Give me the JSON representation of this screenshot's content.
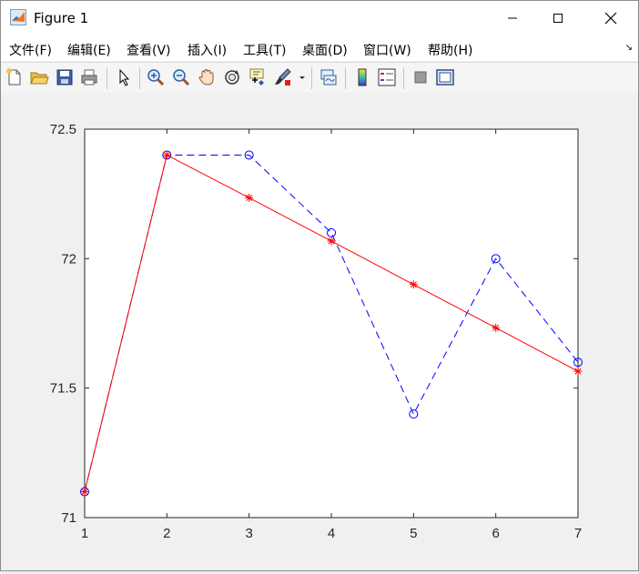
{
  "window": {
    "title": "Figure 1",
    "controls": [
      "minimize",
      "maximize",
      "close"
    ]
  },
  "menu": {
    "items": [
      "文件(F)",
      "编辑(E)",
      "查看(V)",
      "插入(I)",
      "工具(T)",
      "桌面(D)",
      "窗口(W)",
      "帮助(H)"
    ],
    "overflow_symbol": "↘"
  },
  "toolbar": {
    "icons": [
      "new-figure-icon",
      "open-file-icon",
      "save-icon",
      "print-icon",
      "edit-plot-arrow-icon",
      "zoom-in-icon",
      "zoom-out-icon",
      "pan-hand-icon",
      "rotate-3d-icon",
      "data-cursor-icon",
      "brush-icon",
      "link-plot-icon",
      "colorbar-icon",
      "legend-icon",
      "hide-plot-tools-icon",
      "show-plot-tools-icon"
    ]
  },
  "chart_data": {
    "type": "line",
    "title": "",
    "xlabel": "",
    "ylabel": "",
    "xlim": [
      1,
      7
    ],
    "ylim": [
      71,
      72.5
    ],
    "xticks": [
      "1",
      "2",
      "3",
      "4",
      "5",
      "6",
      "7"
    ],
    "yticks": [
      "71",
      "71.5",
      "72",
      "72.5"
    ],
    "grid": false,
    "series": [
      {
        "color": "#0000ff",
        "line": "dashed",
        "marker": "circle",
        "x": [
          1,
          2,
          3,
          4,
          5,
          6,
          7
        ],
        "y": [
          71.1,
          72.4,
          72.4,
          72.1,
          71.4,
          72.0,
          71.6
        ]
      },
      {
        "color": "#ff0000",
        "line": "solid",
        "marker": "asterisk",
        "x": [
          1,
          2,
          3,
          4,
          5,
          6,
          7
        ],
        "y": [
          71.1,
          72.4,
          72.235,
          72.068,
          71.9,
          71.733,
          71.565
        ]
      }
    ]
  }
}
